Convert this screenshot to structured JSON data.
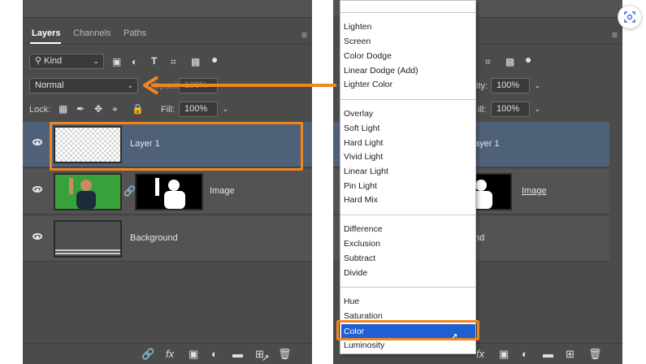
{
  "left": {
    "tabs": [
      {
        "label": "Layers"
      },
      {
        "label": "Channels"
      },
      {
        "label": "Paths"
      }
    ],
    "filter_kind": "Kind",
    "blend_mode": "Normal",
    "opacity_label": "Opacity:",
    "opacity_value": "100%",
    "lock_label": "Lock:",
    "fill_label": "Fill:",
    "fill_value": "100%",
    "layers": [
      {
        "name": "Layer 1"
      },
      {
        "name": "Image"
      },
      {
        "name": "Background"
      }
    ]
  },
  "right": {
    "opacity_label": "ity:",
    "opacity_value": "100%",
    "fill_label": "ill:",
    "fill_value": "100%",
    "layers": [
      {
        "name": "ayer 1"
      },
      {
        "name": "Image"
      },
      {
        "name": "nd"
      }
    ]
  },
  "blend_menu": {
    "items": [
      "Lighten",
      "Screen",
      "Color Dodge",
      "Linear Dodge (Add)",
      "Lighter Color",
      "Overlay",
      "Soft Light",
      "Hard Light",
      "Vivid Light",
      "Linear Light",
      "Pin Light",
      "Hard Mix",
      "Difference",
      "Exclusion",
      "Subtract",
      "Divide",
      "Hue",
      "Saturation",
      "Color",
      "Luminosity"
    ],
    "selected": "Color"
  },
  "colors": {
    "panel_bg": "#4b4b4b",
    "selected_layer": "#4f6079",
    "highlight_blue": "#1e5fd1",
    "annotation_orange": "#f0861f"
  },
  "icons": [
    "search-icon",
    "image-filter-icon",
    "adjustment-filter-icon",
    "type-filter-icon",
    "shape-filter-icon",
    "smart-object-filter-icon",
    "toggle-dot-icon",
    "eye-icon",
    "chain-icon",
    "link-icon",
    "fx-icon",
    "mask-icon",
    "adjustment-icon",
    "folder-icon",
    "new-layer-icon",
    "trash-icon",
    "menu-icon",
    "scan-icon",
    "cursor-icon"
  ]
}
